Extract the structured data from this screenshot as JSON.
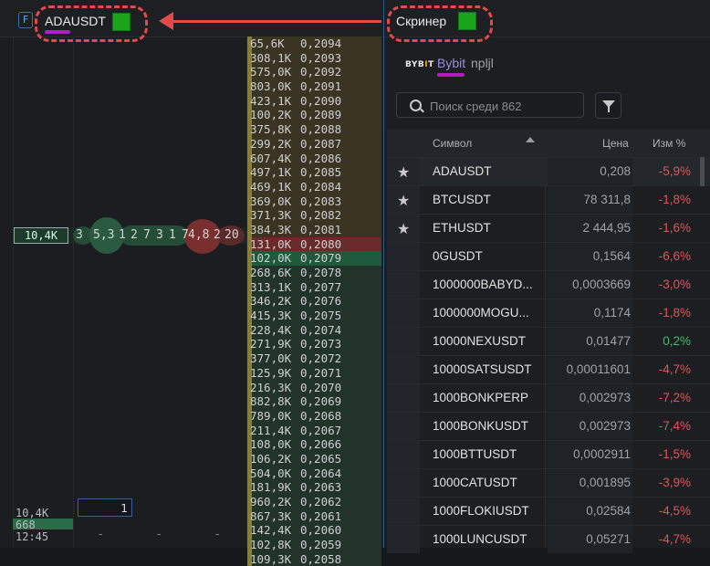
{
  "left_panel": {
    "f_badge": "F",
    "symbol": "ADAUSDT",
    "best_volume": "10,4K",
    "trade_bubbles": [
      "3",
      "5,3",
      "1",
      "2",
      "7",
      "3",
      "1",
      "7",
      "4,8",
      "2",
      "20"
    ],
    "bottom": {
      "volume_1": "10,4K",
      "volume_2": "668",
      "time": "12:45",
      "qty": "1",
      "dashes": [
        "-",
        "-",
        "-",
        "-"
      ]
    }
  },
  "ladder": [
    {
      "vol": "65,6K",
      "price": "0,2094",
      "side": "ask"
    },
    {
      "vol": "308,1K",
      "price": "0,2093",
      "side": "ask"
    },
    {
      "vol": "575,0K",
      "price": "0,2092",
      "side": "ask"
    },
    {
      "vol": "803,0K",
      "price": "0,2091",
      "side": "ask"
    },
    {
      "vol": "423,1K",
      "price": "0,2090",
      "side": "ask"
    },
    {
      "vol": "100,2K",
      "price": "0,2089",
      "side": "ask"
    },
    {
      "vol": "375,8K",
      "price": "0,2088",
      "side": "ask"
    },
    {
      "vol": "299,2K",
      "price": "0,2087",
      "side": "ask"
    },
    {
      "vol": "607,4K",
      "price": "0,2086",
      "side": "ask"
    },
    {
      "vol": "497,1K",
      "price": "0,2085",
      "side": "ask"
    },
    {
      "vol": "469,1K",
      "price": "0,2084",
      "side": "ask"
    },
    {
      "vol": "369,0K",
      "price": "0,2083",
      "side": "ask"
    },
    {
      "vol": "371,3K",
      "price": "0,2082",
      "side": "ask"
    },
    {
      "vol": "384,3K",
      "price": "0,2081",
      "side": "ask"
    },
    {
      "vol": "131,0K",
      "price": "0,2080",
      "side": "askbest"
    },
    {
      "vol": "102,0K",
      "price": "0,2079",
      "side": "bidbest"
    },
    {
      "vol": "268,6K",
      "price": "0,2078",
      "side": "bid"
    },
    {
      "vol": "313,1K",
      "price": "0,2077",
      "side": "bid"
    },
    {
      "vol": "346,2K",
      "price": "0,2076",
      "side": "bid"
    },
    {
      "vol": "415,3K",
      "price": "0,2075",
      "side": "bid"
    },
    {
      "vol": "228,4K",
      "price": "0,2074",
      "side": "bid"
    },
    {
      "vol": "271,9K",
      "price": "0,2073",
      "side": "bid"
    },
    {
      "vol": "377,0K",
      "price": "0,2072",
      "side": "bid"
    },
    {
      "vol": "125,9K",
      "price": "0,2071",
      "side": "bid"
    },
    {
      "vol": "216,3K",
      "price": "0,2070",
      "side": "bid"
    },
    {
      "vol": "882,8K",
      "price": "0,2069",
      "side": "bid"
    },
    {
      "vol": "789,0K",
      "price": "0,2068",
      "side": "bid"
    },
    {
      "vol": "211,4K",
      "price": "0,2067",
      "side": "bid"
    },
    {
      "vol": "108,0K",
      "price": "0,2066",
      "side": "bid"
    },
    {
      "vol": "106,2K",
      "price": "0,2065",
      "side": "bid"
    },
    {
      "vol": "504,0K",
      "price": "0,2064",
      "side": "bid"
    },
    {
      "vol": "181,9K",
      "price": "0,2063",
      "side": "bid"
    },
    {
      "vol": "960,2K",
      "price": "0,2062",
      "side": "bid"
    },
    {
      "vol": "867,3K",
      "price": "0,2061",
      "side": "bid"
    },
    {
      "vol": "142,4K",
      "price": "0,2060",
      "side": "bid"
    },
    {
      "vol": "102,8K",
      "price": "0,2059",
      "side": "bid"
    },
    {
      "vol": "109,3K",
      "price": "0,2058",
      "side": "bid"
    }
  ],
  "screener": {
    "title": "Скринер",
    "exchange_logo": {
      "text_a": "BYB",
      "text_b": "I",
      "text_c": "T"
    },
    "exchange": "Bybit",
    "user": "npljl",
    "search_placeholder": "Поиск среди 862",
    "columns": {
      "symbol": "Символ",
      "price": "Цена",
      "change": "Изм %"
    },
    "rows": [
      {
        "fav": true,
        "symbol": "ADAUSDT",
        "price": "0,208",
        "change": "-5,9%",
        "dir": "neg"
      },
      {
        "fav": true,
        "symbol": "BTCUSDT",
        "price": "78 311,8",
        "change": "-1,8%",
        "dir": "neg"
      },
      {
        "fav": true,
        "symbol": "ETHUSDT",
        "price": "2 444,95",
        "change": "-1,6%",
        "dir": "neg"
      },
      {
        "fav": false,
        "symbol": "0GUSDT",
        "price": "0,1564",
        "change": "-6,6%",
        "dir": "neg"
      },
      {
        "fav": false,
        "symbol": "1000000BABYD...",
        "price": "0,0003669",
        "change": "-3,0%",
        "dir": "neg"
      },
      {
        "fav": false,
        "symbol": "1000000MOGU...",
        "price": "0,1174",
        "change": "-1,8%",
        "dir": "neg"
      },
      {
        "fav": false,
        "symbol": "10000NEXUSDT",
        "price": "0,01477",
        "change": "0,2%",
        "dir": "pos"
      },
      {
        "fav": false,
        "symbol": "10000SATSUSDT",
        "price": "0,00011601",
        "change": "-4,7%",
        "dir": "neg"
      },
      {
        "fav": false,
        "symbol": "1000BONKPERP",
        "price": "0,002973",
        "change": "-7,2%",
        "dir": "neg"
      },
      {
        "fav": false,
        "symbol": "1000BONKUSDT",
        "price": "0,002973",
        "change": "-7,4%",
        "dir": "neg"
      },
      {
        "fav": false,
        "symbol": "1000BTTUSDT",
        "price": "0,0002911",
        "change": "-1,5%",
        "dir": "neg"
      },
      {
        "fav": false,
        "symbol": "1000CATUSDT",
        "price": "0,001895",
        "change": "-3,9%",
        "dir": "neg"
      },
      {
        "fav": false,
        "symbol": "1000FLOKIUSDT",
        "price": "0,02584",
        "change": "-4,5%",
        "dir": "neg"
      },
      {
        "fav": false,
        "symbol": "1000LUNCUSDT",
        "price": "0,05271",
        "change": "-4,7%",
        "dir": "neg"
      }
    ]
  },
  "colors": {
    "annotation": "#e44a4a",
    "underline": "#b21cc4",
    "status_green": "#1aa51a",
    "negative": "#e25555",
    "positive": "#3fbf6f"
  }
}
